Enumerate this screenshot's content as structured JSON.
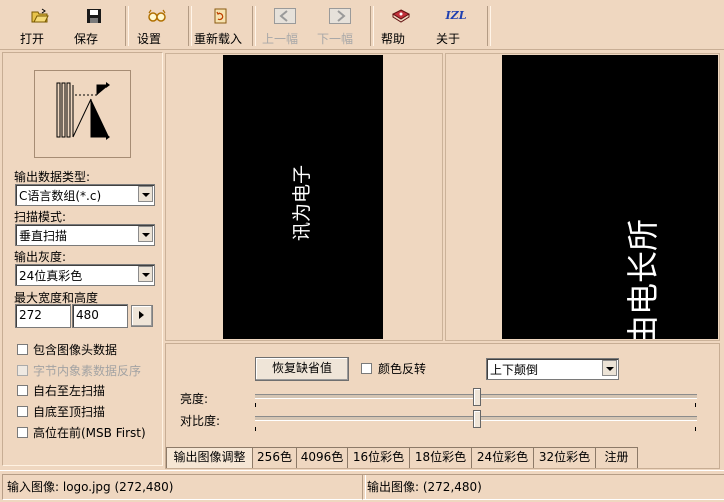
{
  "toolbar": {
    "open": "打开",
    "save": "保存",
    "settings": "设置",
    "reload": "重新载入",
    "prev": "上一幅",
    "next": "下一幅",
    "help": "帮助",
    "about": "关于",
    "about_icon_text": "IZL"
  },
  "left": {
    "output_type_label": "输出数据类型:",
    "output_type_value": "C语言数组(*.c)",
    "scan_mode_label": "扫描模式:",
    "scan_mode_value": "垂直扫描",
    "gray_label": "输出灰度:",
    "gray_value": "24位真彩色",
    "max_size_label": "最大宽度和高度",
    "max_width": "272",
    "max_height": "480",
    "options": [
      {
        "label": "包含图像头数据",
        "checked": false,
        "enabled": true
      },
      {
        "label": "字节内象素数据反序",
        "checked": false,
        "enabled": false
      },
      {
        "label": "自右至左扫描",
        "checked": false,
        "enabled": true
      },
      {
        "label": "自底至顶扫描",
        "checked": false,
        "enabled": true
      },
      {
        "label": "高位在前(MSB First)",
        "checked": false,
        "enabled": true
      }
    ]
  },
  "preview": {
    "input_text": "讯为电子",
    "output_text": "由电长所"
  },
  "bottom": {
    "restore_default": "恢复缺省值",
    "invert_color": "颜色反转",
    "flip_value": "上下颠倒",
    "brightness_label": "亮度:",
    "brightness_value": 0.5,
    "contrast_label": "对比度:",
    "contrast_value": 0.5,
    "tabs": [
      "输出图像调整",
      "256色",
      "4096色",
      "16位彩色",
      "18位彩色",
      "24位彩色",
      "32位彩色",
      "注册"
    ]
  },
  "status": {
    "input": "输入图像:  logo.jpg (272,480)",
    "output": "输出图像:  (272,480)"
  },
  "colors": {
    "background": "#efd7c0",
    "preview_black": "#000000",
    "help_icon": "#c0303a",
    "about_icon": "#2040b0",
    "settings_icon": "#c08000"
  }
}
